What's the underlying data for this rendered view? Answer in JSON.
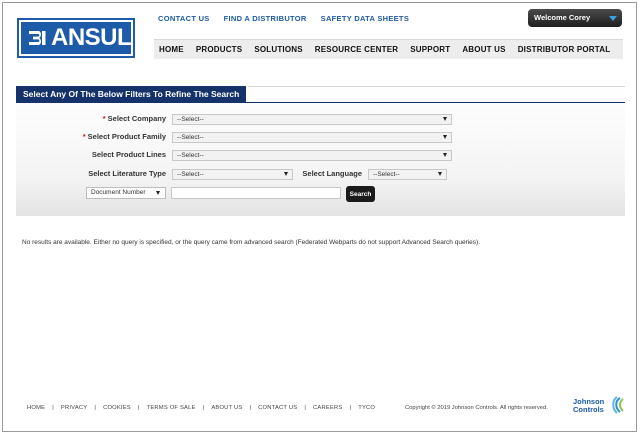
{
  "header": {
    "logo_text": "ANSUL",
    "logo_mark": "ansul-mark-icon",
    "utility_nav": [
      "CONTACT US",
      "FIND A DISTRIBUTOR",
      "SAFETY DATA SHEETS"
    ],
    "welcome_label": "Welcome Corey",
    "main_nav": [
      "HOME",
      "PRODUCTS",
      "SOLUTIONS",
      "RESOURCE CENTER",
      "SUPPORT",
      "ABOUT US",
      "DISTRIBUTOR PORTAL"
    ]
  },
  "filters": {
    "title": "Select Any Of The Below Filters To Refine The Search",
    "company_label": "Select Company",
    "company_value": "--Select--",
    "product_family_label": "Select Product Family",
    "product_family_value": "--Select--",
    "product_lines_label": "Select Product Lines",
    "product_lines_value": "--Select--",
    "literature_type_label": "Select Literature Type",
    "literature_type_value": "--Select--",
    "language_label": "Select Language",
    "language_value": "--Select--",
    "search_field_value": "Document Number",
    "search_input_value": "",
    "search_button": "Search",
    "required_mark": "*"
  },
  "results": {
    "message": "No results are available. Either no query is specified, or the query came from advanced search (Federated Webparts do not support Advanced Search queries)."
  },
  "footer": {
    "links": [
      "HOME",
      "PRIVACY",
      "COOKIES",
      "TERMS OF SALE",
      "ABOUT US",
      "CONTACT US",
      "CAREERS",
      "TYCO"
    ],
    "separator": "|",
    "copyright": "Copyright © 2019 Johnson Controls. All rights reserved.",
    "brand_line1": "Johnson",
    "brand_line2": "Controls"
  },
  "colors": {
    "brand_blue": "#1d5aa7",
    "panel_navy": "#15326a",
    "required_red": "#c21a1a"
  }
}
